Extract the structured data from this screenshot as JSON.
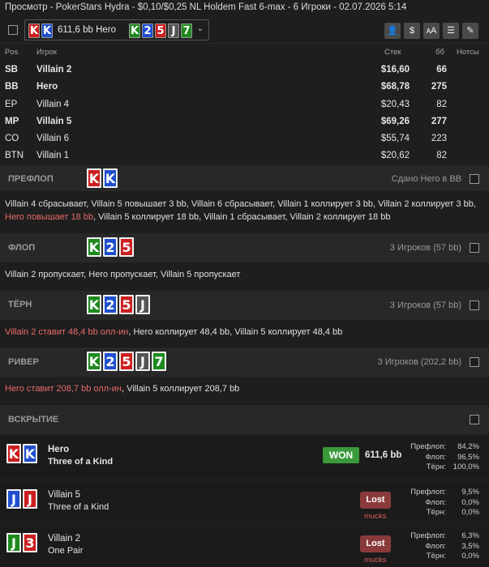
{
  "title": "Просмотр - PokerStars Hydra - $0,10/$0,25 NL Holdem Fast 6-max  - 6 Игроки - 02.07.2026 5:14",
  "toolbar": {
    "hand_label": "611,6 bb Hero",
    "hero_cards": [
      "K",
      "K"
    ],
    "board_cards": [
      "K",
      "2",
      "5",
      "J",
      "7"
    ],
    "chevron": "⌄",
    "btn_icons": [
      "user-icon",
      "dollar-icon",
      "font-size-icon",
      "list-icon",
      "pencil-icon"
    ],
    "btn_glyphs": [
      "👤",
      "$",
      "ᴀA",
      "☰",
      "✎"
    ]
  },
  "columns": {
    "pos": "Pos",
    "player": "Игрок",
    "stack": "Стек",
    "bb": "бб",
    "notes": "Нотсы"
  },
  "players": [
    {
      "pos": "SB",
      "name": "Villain 2",
      "stack": "$16,60",
      "bb": "66",
      "bold": true
    },
    {
      "pos": "BB",
      "name": "Hero",
      "stack": "$68,78",
      "bb": "275",
      "bold": true
    },
    {
      "pos": "EP",
      "name": "Villain 4",
      "stack": "$20,43",
      "bb": "82",
      "bold": false
    },
    {
      "pos": "MP",
      "name": "Villain 5",
      "stack": "$69,26",
      "bb": "277",
      "bold": true
    },
    {
      "pos": "CO",
      "name": "Villain 6",
      "stack": "$55,74",
      "bb": "223",
      "bold": false
    },
    {
      "pos": "BTN",
      "name": "Villain 1",
      "stack": "$20,62",
      "bb": "82",
      "bold": false
    }
  ],
  "streets": {
    "preflop": {
      "name": "ПРЕФЛОП",
      "info": "Сдано Hero в BB",
      "cards": [
        "K",
        "K"
      ],
      "act1": "Villain 4 сбрасывает, Villain 5 повышает 3 bb, Villain 6 сбрасывает, Villain 1 коллирует 3 bb, Villain 2 коллирует 3 bb, ",
      "act_red": "Hero повышает 18 bb",
      "act2": ", Villain 5 коллирует 18 bb, Villain 1 сбрасывает, Villain 2 коллирует 18 bb"
    },
    "flop": {
      "name": "ФЛОП",
      "info": "3 Игроков (57 bb)",
      "cards": [
        "K",
        "2",
        "5"
      ],
      "act": "Villain 2 пропускает, Hero пропускает, Villain 5 пропускает"
    },
    "turn": {
      "name": "ТЁРН",
      "info": "3 Игроков (57 bb)",
      "cards": [
        "K",
        "2",
        "5",
        "J"
      ],
      "act_red": "Villain 2 ставит 48,4 bb олл-ин",
      "act2": ", Hero коллирует 48,4 bb, Villain 5 коллирует 48,4 bb"
    },
    "river": {
      "name": "РИВЕР",
      "info": "3 Игроков (202,2 bb)",
      "cards": [
        "K",
        "2",
        "5",
        "J",
        "7"
      ],
      "act_red": "Hero ставит 208,7 bb олл-ин",
      "act2": ", Villain 5 коллирует 208,7 bb"
    },
    "showdown": {
      "name": "ВСКРЫТИЕ"
    }
  },
  "showdown": [
    {
      "name": "Hero",
      "hand": "Three of a Kind",
      "cards": [
        "K",
        "K"
      ],
      "result": "WON",
      "amount": "611,6 bb",
      "eq": [
        [
          "Префлоп:",
          "84,2%"
        ],
        [
          "Флоп:",
          "96,5%"
        ],
        [
          "Тёрн:",
          "100,0%"
        ]
      ]
    },
    {
      "name": "Villain 5",
      "hand": "Three of a Kind",
      "cards": [
        "J",
        "J"
      ],
      "result": "Lost",
      "mucks": "mucks",
      "eq": [
        [
          "Префлоп:",
          "9,5%"
        ],
        [
          "Флоп:",
          "0,0%"
        ],
        [
          "Тёрн:",
          "0,0%"
        ]
      ]
    },
    {
      "name": "Villain 2",
      "hand": "One Pair",
      "cards": [
        "J",
        "3"
      ],
      "result": "Lost",
      "mucks": "mucks",
      "eq": [
        [
          "Префлоп:",
          "6,3%"
        ],
        [
          "Флоп:",
          "3,5%"
        ],
        [
          "Тёрн:",
          "0,0%"
        ]
      ]
    }
  ]
}
